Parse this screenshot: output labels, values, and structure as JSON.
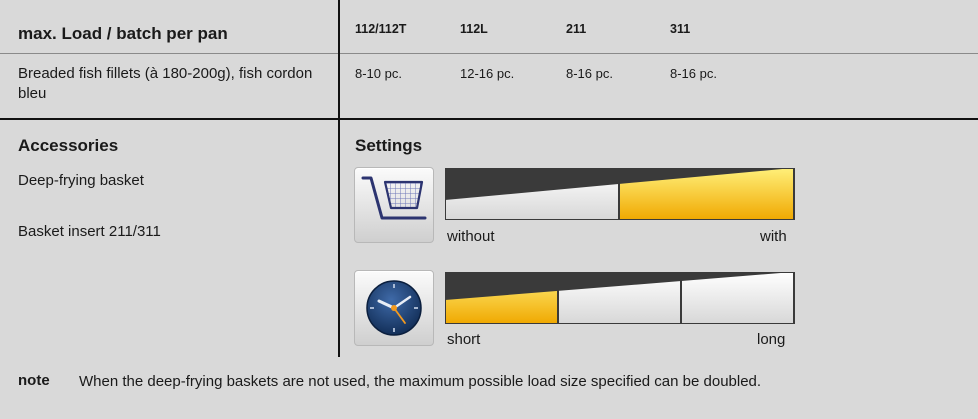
{
  "load_table": {
    "title": "max. Load / batch per pan",
    "columns": [
      "112/112T",
      "112L",
      "211",
      "311"
    ],
    "food": "Breaded fish fillets (à 180-200g), fish cordon bleu",
    "values": [
      "8-10 pc.",
      "12-16 pc.",
      "8-16 pc.",
      "8-16 pc."
    ]
  },
  "accessories": {
    "title": "Accessories",
    "items": [
      "Deep-frying basket",
      "Basket insert 211/311"
    ]
  },
  "settings": {
    "title": "Settings",
    "basket": {
      "icon": "basket-icon",
      "min_label": "without",
      "max_label": "with",
      "selected_segment": 2,
      "segments": 2
    },
    "time": {
      "icon": "clock-icon",
      "min_label": "short",
      "max_label": "long",
      "selected_segment": 1,
      "segments": 3
    }
  },
  "note": {
    "label": "note",
    "text": "When the deep-frying baskets are not used, the maximum possible load size specified can be doubled."
  },
  "colors": {
    "background": "#d9d9d9",
    "active_segment": "#f5b800",
    "inactive_segment": "#f2f2f2",
    "clock_face": "#1d3f6e"
  }
}
